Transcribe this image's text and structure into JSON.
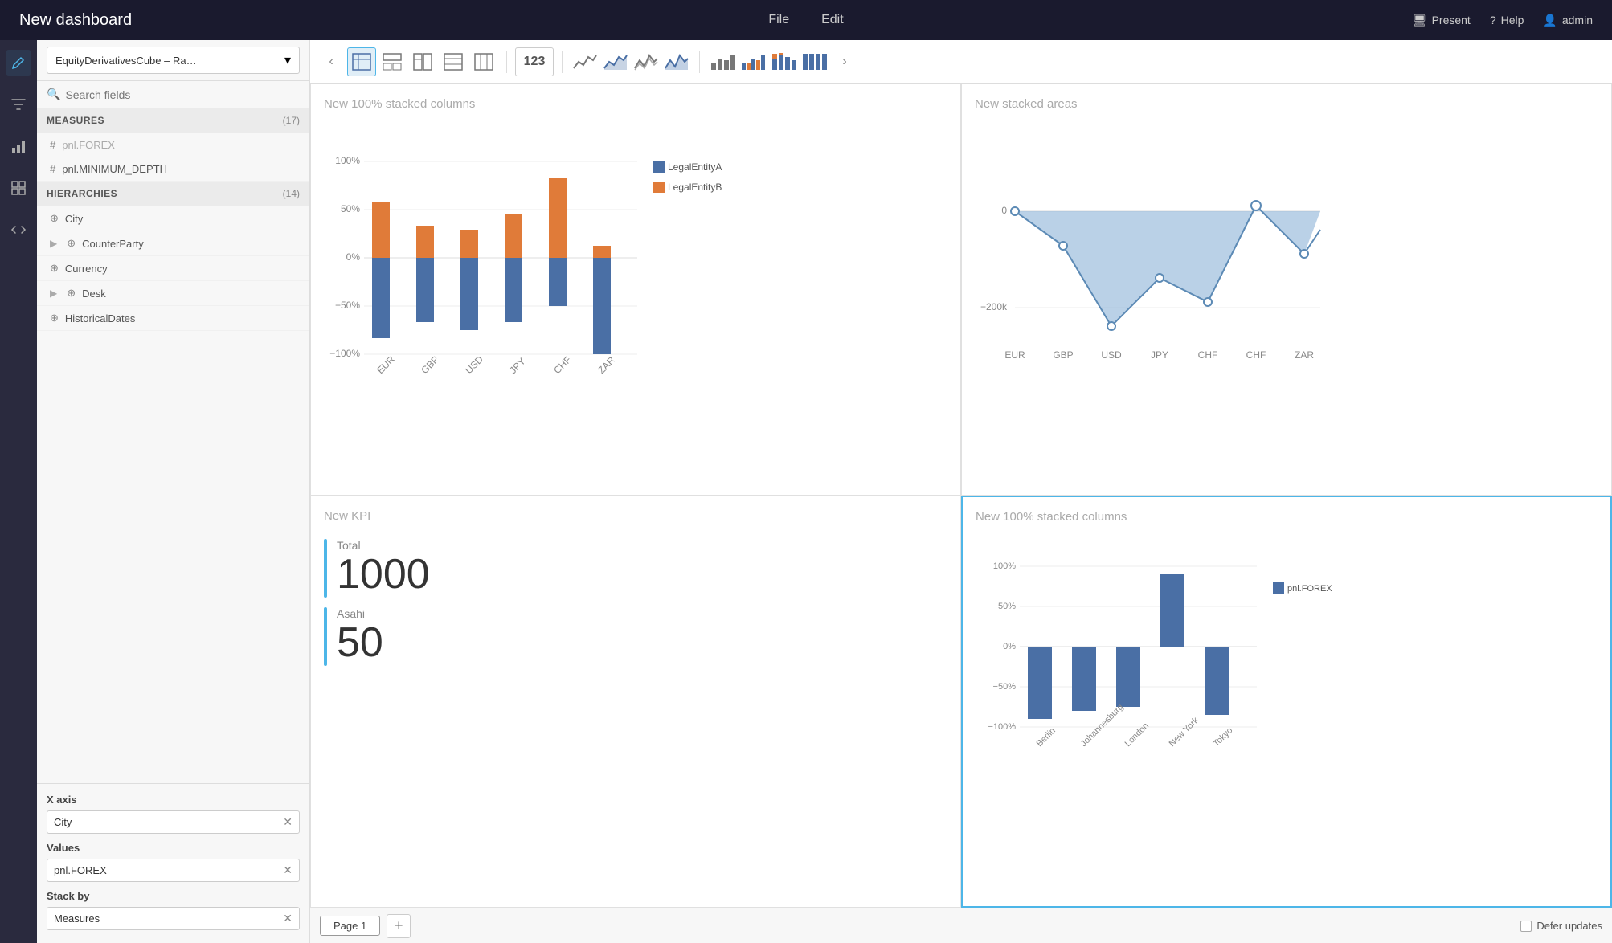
{
  "topbar": {
    "title": "New dashboard",
    "nav_items": [
      "File",
      "Edit"
    ],
    "right_items": [
      {
        "icon": "monitor-icon",
        "label": "Present"
      },
      {
        "icon": "help-icon",
        "label": "Help"
      },
      {
        "icon": "user-icon",
        "label": "admin"
      }
    ]
  },
  "icon_sidebar": {
    "items": [
      {
        "icon": "pencil-icon",
        "label": "Edit",
        "active": true
      },
      {
        "icon": "filter-icon",
        "label": "Filter"
      },
      {
        "icon": "chart-icon",
        "label": "Chart"
      },
      {
        "icon": "grid-icon",
        "label": "Grid"
      },
      {
        "icon": "code-icon",
        "label": "Code"
      }
    ]
  },
  "left_panel": {
    "datasource": "EquityDerivativesCube – Ra…",
    "search_placeholder": "Search fields",
    "measures": {
      "title": "MEASURES",
      "count": "(17)",
      "items": [
        {
          "name": "pnl.FOREX",
          "dimmed": true
        },
        {
          "name": "pnl.MINIMUM_DEPTH",
          "dimmed": false
        }
      ]
    },
    "hierarchies": {
      "title": "HIERARCHIES",
      "count": "(14)",
      "items": [
        {
          "name": "City",
          "expandable": false
        },
        {
          "name": "CounterParty",
          "expandable": true
        },
        {
          "name": "Currency",
          "expandable": false
        },
        {
          "name": "Desk",
          "expandable": true
        },
        {
          "name": "HistoricalDates",
          "expandable": false
        }
      ]
    }
  },
  "config": {
    "xaxis_label": "X axis",
    "xaxis_value": "City",
    "values_label": "Values",
    "values_value": "pnl.FOREX",
    "stackby_label": "Stack by",
    "stackby_value": "Measures"
  },
  "charts": {
    "chart1": {
      "title": "New 100% stacked columns",
      "legend": [
        {
          "color": "#4a6fa5",
          "label": "LegalEntityA"
        },
        {
          "color": "#e07b39",
          "label": "LegalEntityB"
        }
      ],
      "x_labels": [
        "EUR",
        "GBP",
        "USD",
        "JPY",
        "CHF",
        "ZAR"
      ],
      "y_labels": [
        "100%",
        "50%",
        "0%",
        "-50%",
        "-100%"
      ]
    },
    "chart2": {
      "title": "New stacked areas",
      "x_labels": [
        "EUR",
        "GBP",
        "USD",
        "JPY",
        "CHF",
        "ZAR"
      ],
      "y_labels": [
        "0",
        "-200k"
      ]
    },
    "chart3": {
      "title": "New KPI",
      "total_label": "Total",
      "total_value": "1000",
      "asahi_label": "Asahi",
      "asahi_value": "50"
    },
    "chart4": {
      "title": "New 100% stacked columns",
      "legend": [
        {
          "color": "#4a6fa5",
          "label": "pnl.FOREX"
        }
      ],
      "x_labels": [
        "Berlin",
        "Johannesburg",
        "London",
        "New York",
        "Tokyo"
      ],
      "y_labels": [
        "100%",
        "50%",
        "0%",
        "-50%",
        "-100%"
      ]
    }
  },
  "bottom_bar": {
    "page_label": "Page 1",
    "add_label": "+",
    "defer_label": "Defer updates"
  },
  "toolbar": {
    "prev_arrow": "‹",
    "next_arrow": "›",
    "kpi_label": "123"
  }
}
